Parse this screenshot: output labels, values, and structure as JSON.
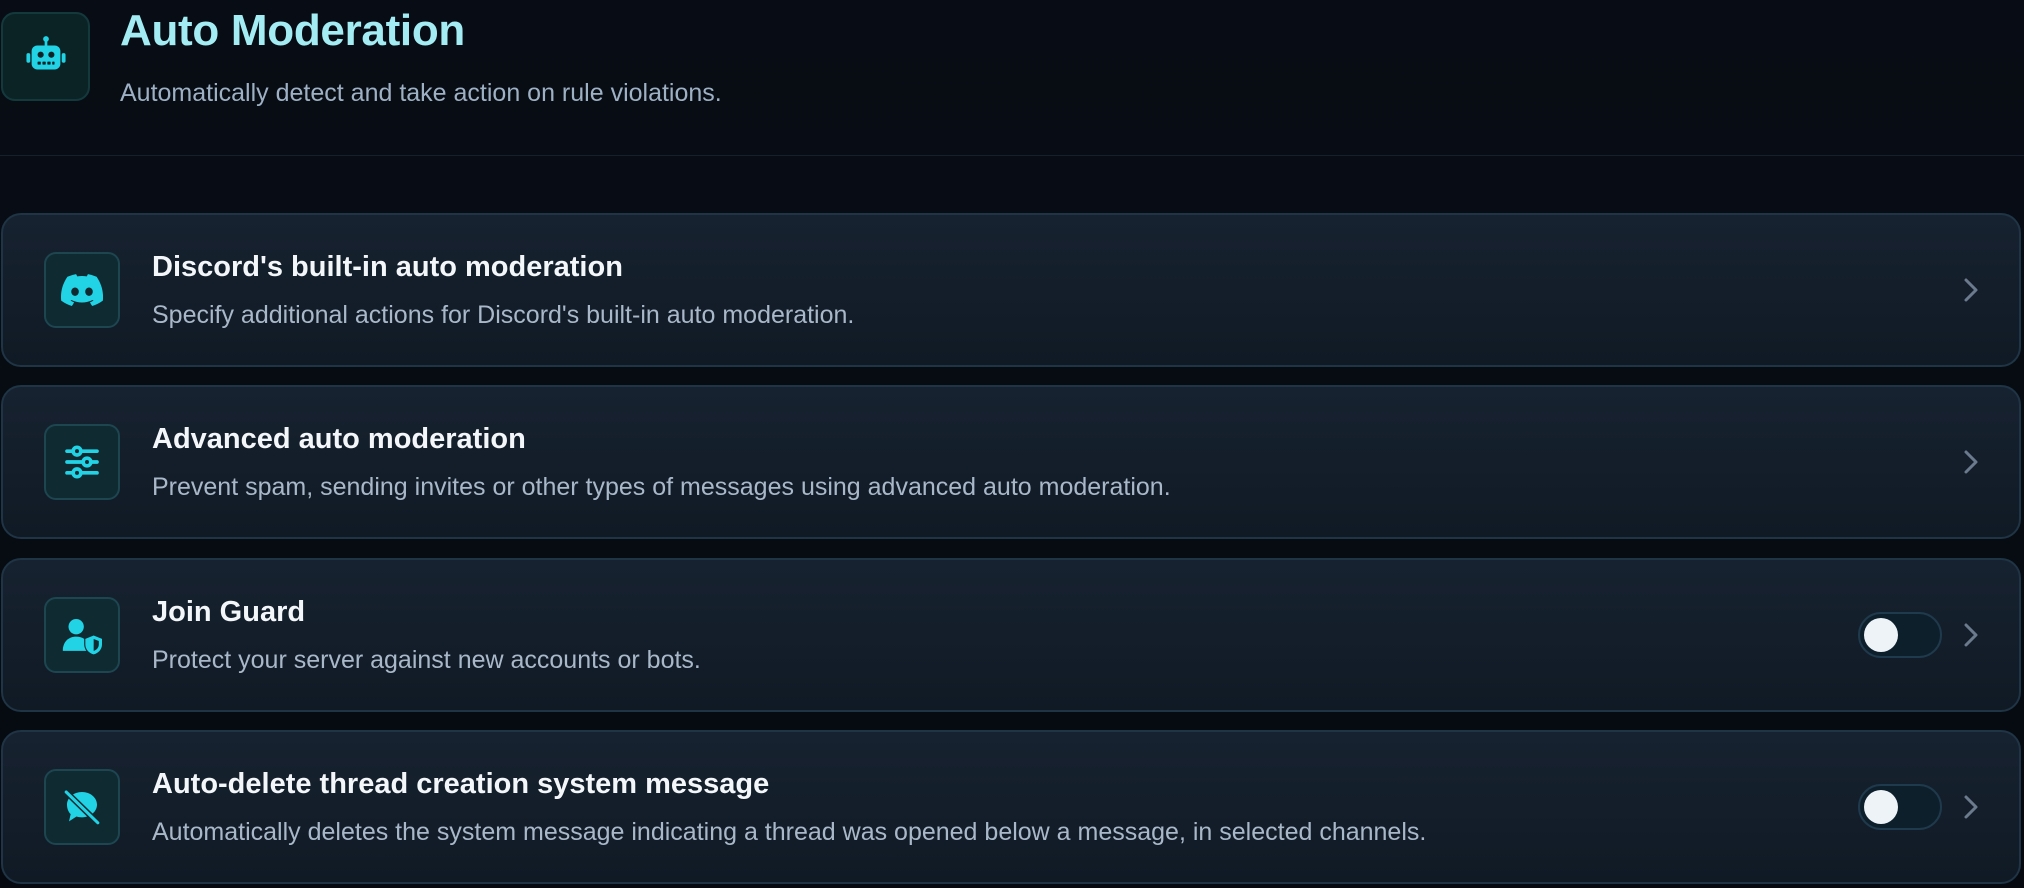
{
  "header": {
    "title": "Auto Moderation",
    "subtitle": "Automatically detect and take action on rule violations.",
    "icon": "robot-icon"
  },
  "colors": {
    "accent": "#22d3e6",
    "title": "#a4ecf4",
    "card_background": "#141f2b",
    "page_background": "#070b12"
  },
  "modules": [
    {
      "title": "Discord's built-in auto moderation",
      "description": "Specify additional actions for Discord's built-in auto moderation.",
      "icon": "discord-icon",
      "has_toggle": false
    },
    {
      "title": "Advanced auto moderation",
      "description": "Prevent spam, sending invites or other types of messages using advanced auto moderation.",
      "icon": "sliders-icon",
      "has_toggle": false
    },
    {
      "title": "Join Guard",
      "description": "Protect your server against new accounts or bots.",
      "icon": "user-shield-icon",
      "has_toggle": true,
      "enabled": false
    },
    {
      "title": "Auto-delete thread creation system message",
      "description": "Automatically deletes the system message indicating a thread was opened below a message, in selected channels.",
      "icon": "message-slash-icon",
      "has_toggle": true,
      "enabled": false
    }
  ]
}
